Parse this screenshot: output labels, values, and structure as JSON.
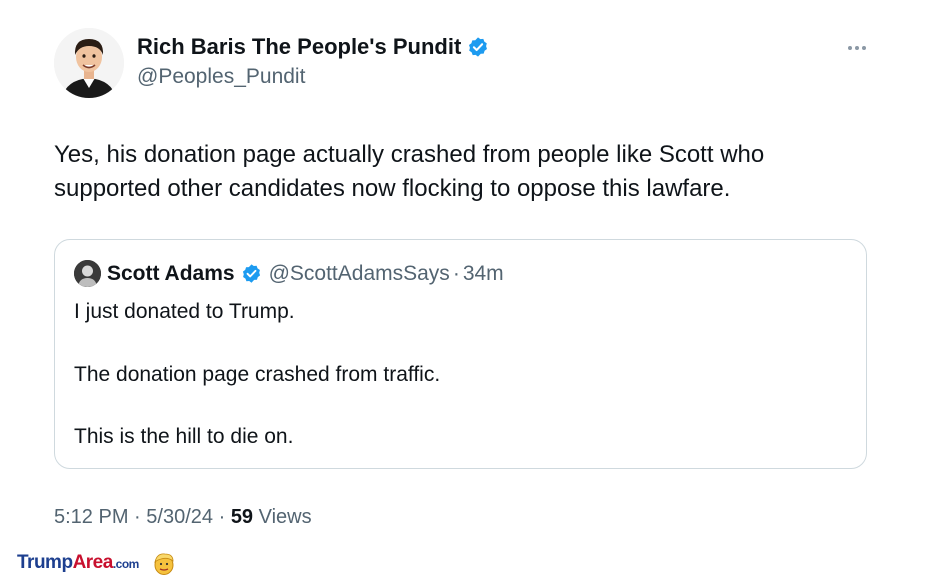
{
  "author": {
    "name": "Rich Baris The People's Pundit",
    "handle": "@Peoples_Pundit",
    "verified": true,
    "avatar_icon": "cartoon-avatar-icon"
  },
  "tweet": {
    "lines": [
      "Yes, his donation page actually crashed from people like Scott who",
      "supported other candidates now flocking to oppose this lawfare."
    ]
  },
  "quoted_tweet": {
    "author_name": "Scott Adams",
    "handle": "@ScottAdamsSays",
    "separator": "·",
    "time": "34m",
    "verified": true,
    "lines": [
      "I just donated to Trump.",
      "The donation page crashed from traffic.",
      "This is the hill to die on."
    ]
  },
  "meta": {
    "time": "5:12 PM",
    "date": "5/30/24",
    "separator": "·",
    "views_count": "59",
    "views_label": "Views"
  },
  "watermark": {
    "part1": "Trump",
    "part2": "Area",
    "part3": ".com"
  },
  "colors": {
    "verified_blue": "#1d9bf0",
    "secondary_text": "#536471",
    "border": "#cfd9de"
  }
}
